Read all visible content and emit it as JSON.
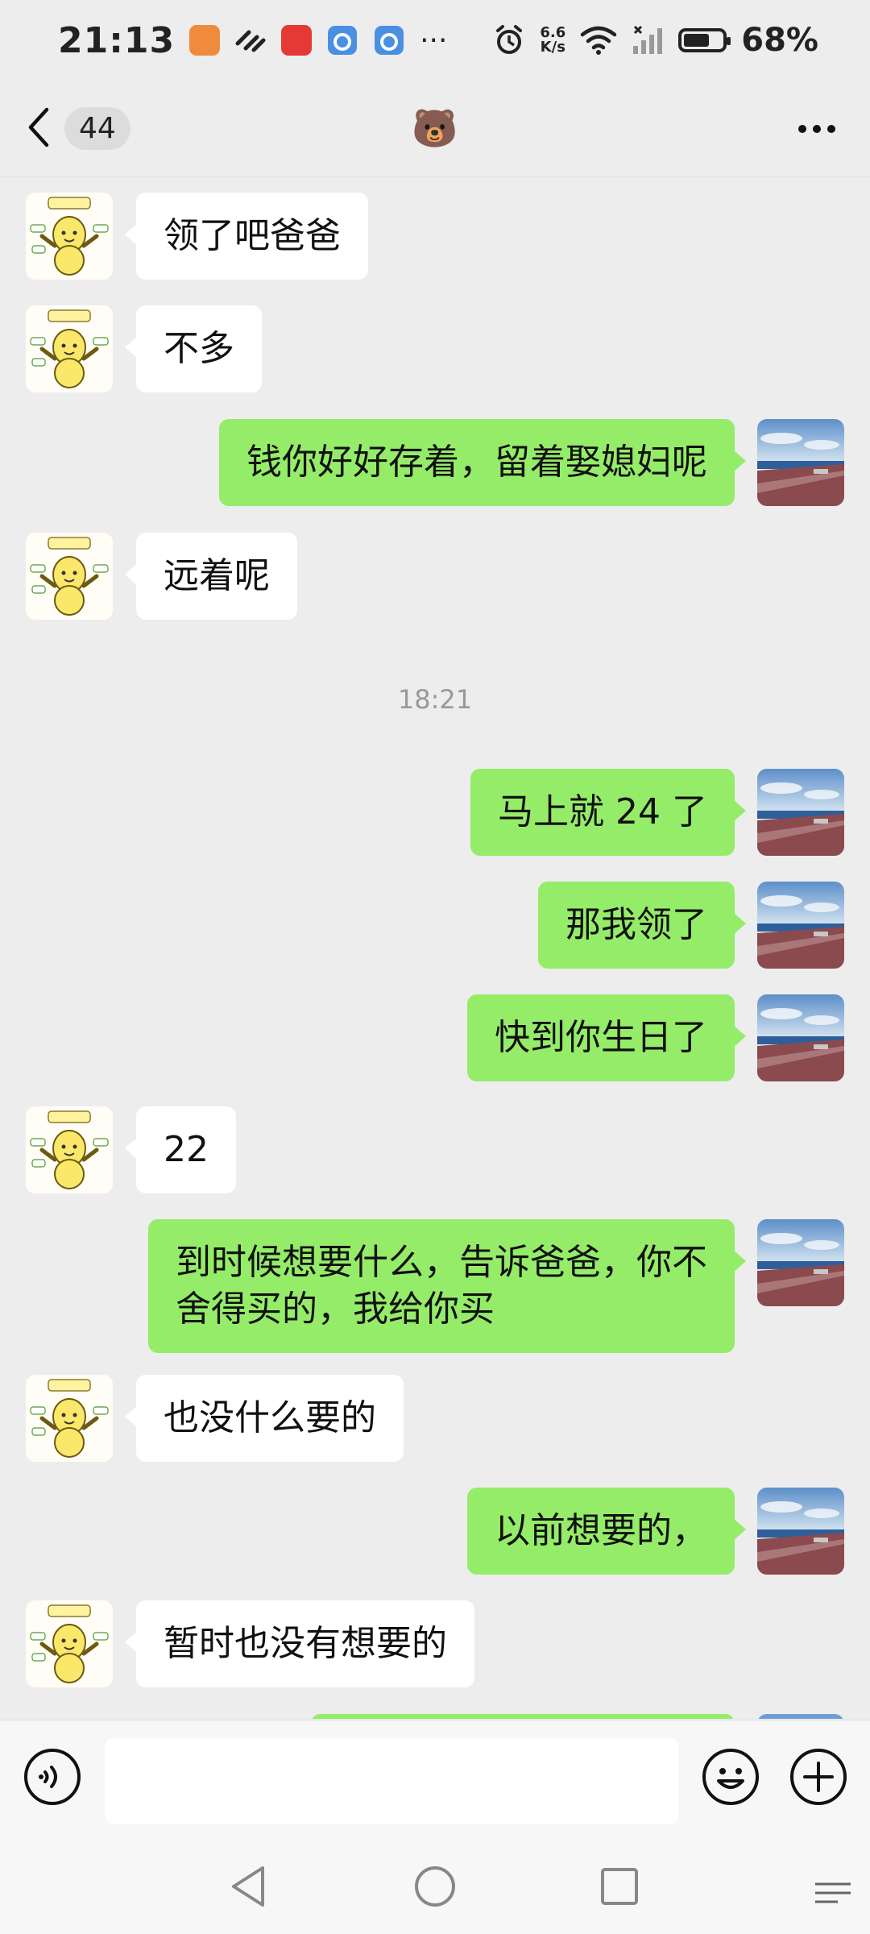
{
  "status_bar": {
    "time": "21:13",
    "net_speed_value": "6.6",
    "net_speed_unit": "K/s",
    "battery": "68%",
    "battery_level": 0.68
  },
  "header": {
    "unread_count": "44",
    "title": "🐻"
  },
  "chat": {
    "timestamp": "18:21",
    "messages": [
      {
        "side": "in",
        "text": "领了吧爸爸"
      },
      {
        "side": "in",
        "text": "不多"
      },
      {
        "side": "out",
        "text": "钱你好好存着，留着娶媳妇呢"
      },
      {
        "side": "in",
        "text": "远着呢"
      },
      {
        "side": "out",
        "text": "马上就 24 了"
      },
      {
        "side": "out",
        "text": "那我领了"
      },
      {
        "side": "out",
        "text": "快到你生日了"
      },
      {
        "side": "in",
        "text": "22"
      },
      {
        "side": "out",
        "text": "到时候想要什么，告诉爸爸，你不\n舍得买的，我给你买"
      },
      {
        "side": "in",
        "text": "也没什么要的"
      },
      {
        "side": "out",
        "text": "以前想要的，"
      },
      {
        "side": "in",
        "text": "暂时也没有想要的"
      }
    ]
  },
  "icons": {
    "back": "chevron-left-icon",
    "more": "more-dots-icon",
    "voice": "voice-icon",
    "emoji": "emoji-icon",
    "plus": "plus-icon"
  },
  "colors": {
    "outgoing_bubble": "#95ec69",
    "incoming_bubble": "#ffffff",
    "background": "#ededed"
  }
}
